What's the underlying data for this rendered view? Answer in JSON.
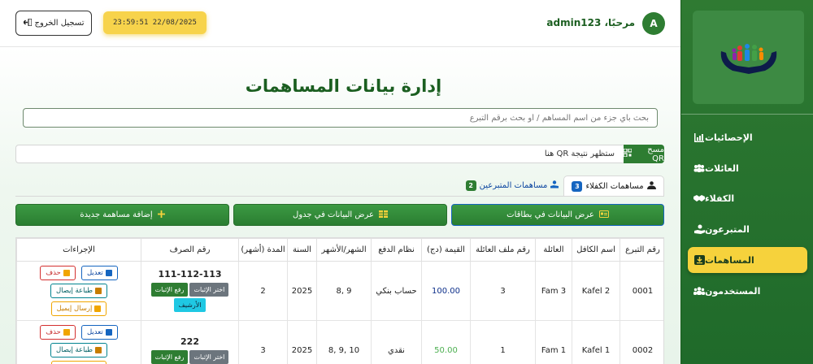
{
  "sidebar": {
    "items": [
      {
        "label": "الإحصائيات",
        "icon": "chart-icon"
      },
      {
        "label": "العائلات",
        "icon": "users-icon"
      },
      {
        "label": "الكفلاء",
        "icon": "handshake-icon"
      },
      {
        "label": "المتبرعون",
        "icon": "donate-hand-icon"
      },
      {
        "label": "المساهمات",
        "icon": "download-icon",
        "active": true
      },
      {
        "label": "المستخدمون",
        "icon": "user-group-icon"
      }
    ],
    "active_color": "#f6d23c"
  },
  "header": {
    "avatar_letter": "A",
    "welcome": "مرحبًا، admin123",
    "clock": "23:59:51  22/08/2025",
    "logout_label": "تسجيل الخروج"
  },
  "main": {
    "title": "إدارة بيانات المساهمات",
    "search_placeholder": "بحث بأي جزء من اسم المساهم / أو بحث برقم التبرع",
    "qr_button": "مسح QR",
    "qr_result": "ستظهر نتيجة QR هنا",
    "tabs": [
      {
        "label": "مساهمات الكفلاء",
        "count": "3",
        "badge_color": "#1565c0"
      },
      {
        "label": "مساهمات المتبرعين",
        "count": "2",
        "badge_color": "#2e7d32"
      }
    ],
    "buttons": {
      "cards": "عرض البيانات في بطاقات",
      "table": "عرض البيانات في جدول",
      "add": "إضافة مساهمة جديدة"
    }
  },
  "table": {
    "columns": [
      "رقم التبرع",
      "اسم الكافل",
      "العائلة",
      "رقم ملف العائلة",
      "القيمة (دج)",
      "نظام الدفع",
      "الشهر/الأشهر",
      "السنة",
      "المدة (أشهر)",
      "رقم الصرف",
      "الإجراءات"
    ],
    "rows": [
      {
        "id": "0001",
        "sponsor": "Kafel 2",
        "family": "Fam 3",
        "file": "3",
        "value": "100.00",
        "payment": "حساب بنكي",
        "months": "9 ,8",
        "year": "2025",
        "duration": "2",
        "voucher": "111-112-113"
      },
      {
        "id": "0002",
        "sponsor": "Kafel 1",
        "family": "Fam 1",
        "file": "1",
        "value": "50.00",
        "payment": "نقدي",
        "months": "10 ,9 ,8",
        "year": "2025",
        "duration": "3",
        "voucher": "222"
      }
    ],
    "row_actions": {
      "choose_proof": "اختر الإثبات",
      "upload_proof": "رفع الإثبات",
      "archive": "الأرشيف",
      "delete": "حذف",
      "edit": "تعديل",
      "print_receipt": "طباعة إيصال",
      "send_email": "إرسال إيميل"
    }
  }
}
